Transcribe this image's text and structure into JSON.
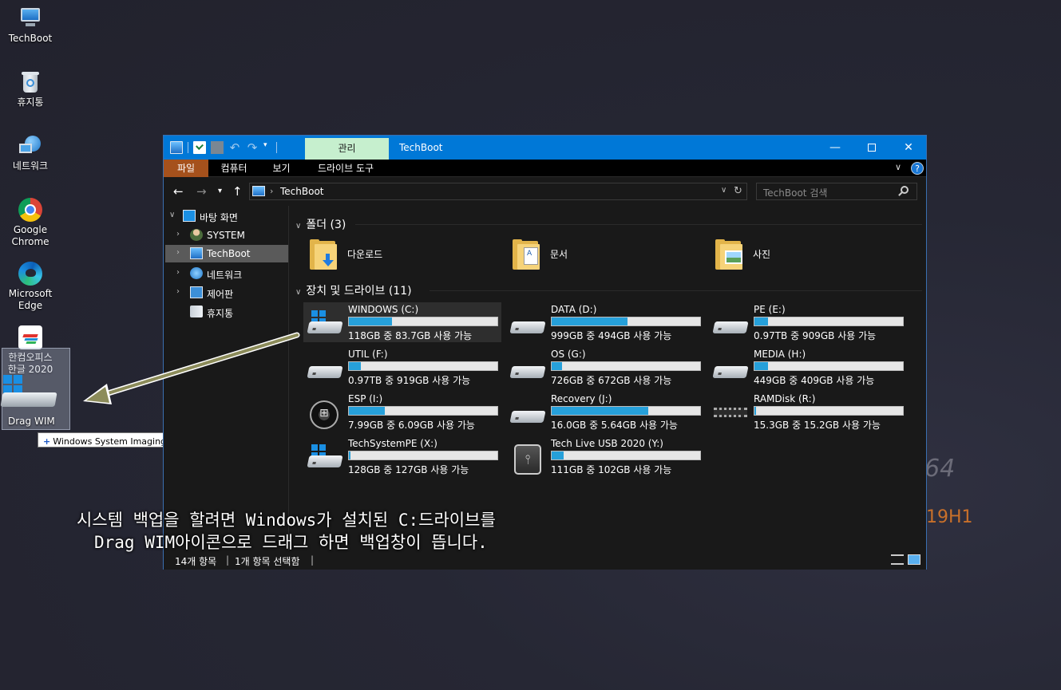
{
  "wallpaper": {
    "arch_text": "64",
    "version_text": "19H1"
  },
  "desktop": {
    "icons": [
      {
        "label": "TechBoot",
        "icon": "computer-icon"
      },
      {
        "label": "휴지통",
        "icon": "recycle-bin-icon"
      },
      {
        "label": "네트워크",
        "icon": "network-icon"
      },
      {
        "label": "Google Chrome",
        "icon": "chrome-icon"
      },
      {
        "label": "Microsoft Edge",
        "icon": "edge-icon"
      },
      {
        "label": "한컴오피스 한글 2020",
        "icon": "hwp-icon"
      }
    ],
    "drag": {
      "label": "Drag WIM",
      "tooltip": "Windows System Imaging(으)로 열기"
    }
  },
  "window": {
    "title": "TechBoot",
    "contextual_tab": "관리",
    "ribbon_tabs": [
      "파일",
      "컴퓨터",
      "보기",
      "드라이브 도구"
    ],
    "address": {
      "path": "TechBoot"
    },
    "search": {
      "placeholder": "TechBoot 검색"
    },
    "nav_pane": [
      {
        "label": "바탕 화면",
        "expanded": true
      },
      {
        "label": "SYSTEM"
      },
      {
        "label": "TechBoot",
        "selected": true
      },
      {
        "label": "네트워크"
      },
      {
        "label": "제어판"
      },
      {
        "label": "휴지통"
      }
    ],
    "folders_header": "폴더 (3)",
    "folders": [
      {
        "name": "다운로드",
        "icon": "downloads-folder-icon"
      },
      {
        "name": "문서",
        "icon": "documents-folder-icon"
      },
      {
        "name": "사진",
        "icon": "pictures-folder-icon"
      }
    ],
    "drives_header": "장치 및 드라이브 (11)",
    "drives": [
      {
        "name": "WINDOWS (C:)",
        "space": "118GB 중 83.7GB 사용 가능",
        "used_fraction": 0.29,
        "icon": "windows-drive-icon",
        "selected": true
      },
      {
        "name": "DATA (D:)",
        "space": "999GB 중 494GB 사용 가능",
        "used_fraction": 0.51,
        "icon": "hard-drive-icon"
      },
      {
        "name": "PE (E:)",
        "space": "0.97TB 중 909GB 사용 가능",
        "used_fraction": 0.09,
        "icon": "hard-drive-icon"
      },
      {
        "name": "UTIL (F:)",
        "space": "0.97TB 중 919GB 사용 가능",
        "used_fraction": 0.08,
        "icon": "hard-drive-icon"
      },
      {
        "name": "OS (G:)",
        "space": "726GB 중 672GB 사용 가능",
        "used_fraction": 0.07,
        "icon": "hard-drive-icon"
      },
      {
        "name": "MEDIA (H:)",
        "space": "449GB 중 409GB 사용 가능",
        "used_fraction": 0.09,
        "icon": "hard-drive-icon"
      },
      {
        "name": "ESP (I:)",
        "space": "7.99GB 중 6.09GB 사용 가능",
        "used_fraction": 0.24,
        "icon": "optical-disc-icon"
      },
      {
        "name": "Recovery (J:)",
        "space": "16.0GB 중 5.64GB 사용 가능",
        "used_fraction": 0.65,
        "icon": "hard-drive-icon"
      },
      {
        "name": "RAMDisk (R:)",
        "space": "15.3GB 중 15.2GB 사용 가능",
        "used_fraction": 0.01,
        "icon": "ram-chip-icon"
      },
      {
        "name": "TechSystemPE (X:)",
        "space": "128GB 중 127GB 사용 가능",
        "used_fraction": 0.01,
        "icon": "windows-drive-icon"
      },
      {
        "name": "Tech Live USB 2020 (Y:)",
        "space": "111GB 중 102GB 사용 가능",
        "used_fraction": 0.08,
        "icon": "usb-drive-icon"
      }
    ],
    "status": {
      "items": "14개 항목",
      "selected": "1개 항목 선택함"
    }
  },
  "annotation": {
    "line1": "시스템 백업을 할려면 Windows가 설치된 C:드라이브를",
    "line2": "Drag WIM아이콘으로 드래그 하면 백업창이 뜹니다."
  },
  "colors": {
    "titlebar": "#0078d7",
    "file_tab": "#a5511c",
    "contextual_tab": "#c6efce",
    "usage_bar": "#26a0da",
    "arrow": "#8c8c5a"
  }
}
